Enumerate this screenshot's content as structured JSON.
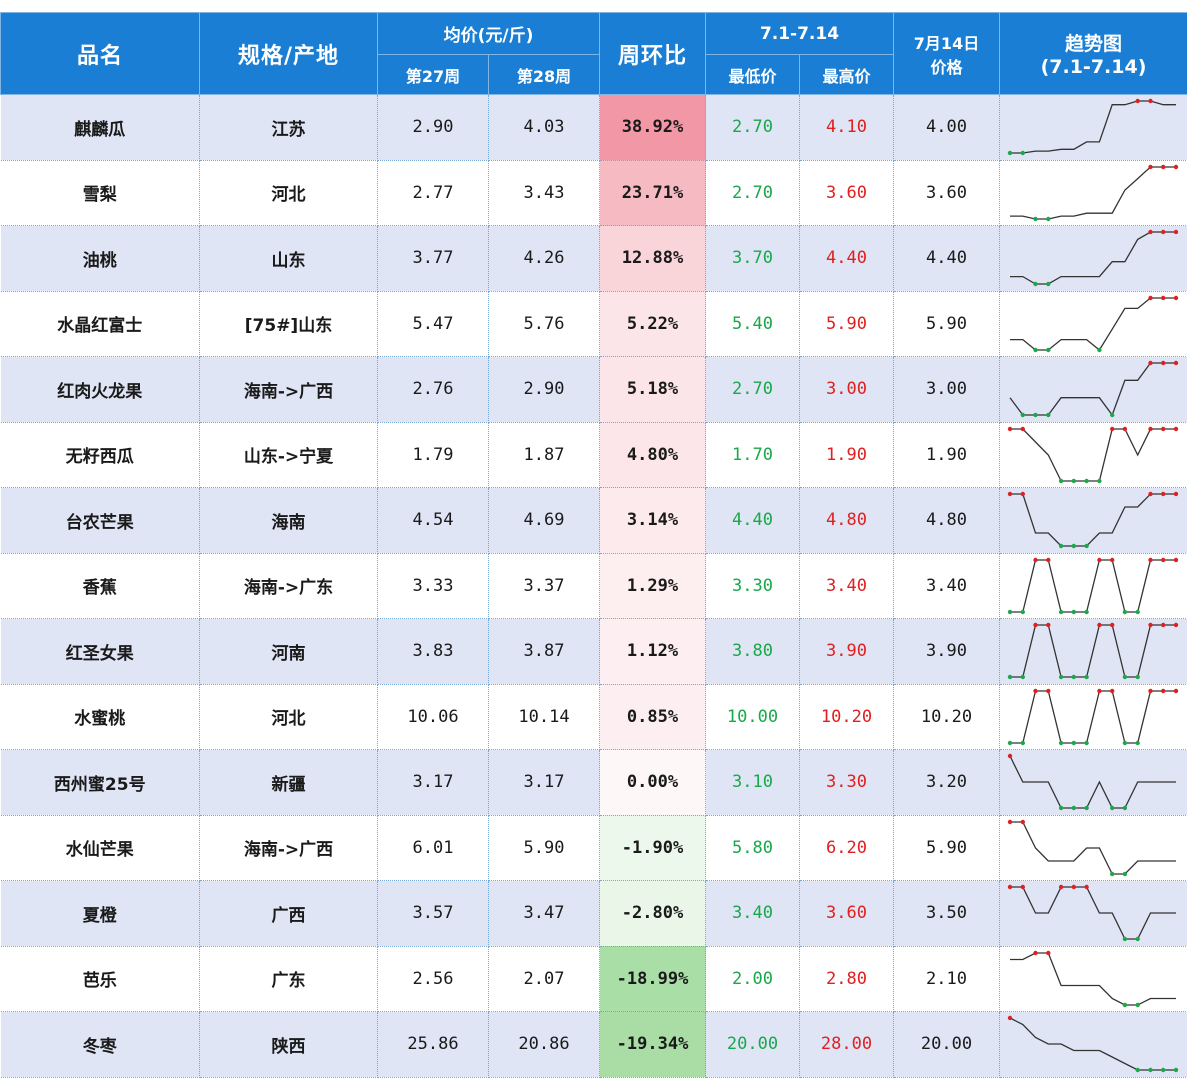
{
  "header": {
    "name": "品名",
    "spec": "规格/产地",
    "avg": "均价(元/斤)",
    "w27": "第27周",
    "w28": "第28周",
    "wow": "周环比",
    "range": "7.1-7.14",
    "min": "最低价",
    "max": "最高价",
    "today_line1": "7月14日",
    "today_line2": "价格",
    "trend_line1": "趋势图",
    "trend_line2": "(7.1-7.14)"
  },
  "colors": {
    "header_bg": "#1a7ed4",
    "row_odd": "#dfe5f5",
    "min_green": "#19a84a",
    "max_red": "#e02020",
    "pct_pos": "#f4a6b0",
    "pct_neg": "#a8dba6"
  },
  "rows": [
    {
      "name": "麒麟瓜",
      "origin": "江苏",
      "w27": "2.90",
      "w28": "4.03",
      "wow": "38.92%",
      "wow_num": 38.92,
      "min": "2.70",
      "max": "4.10",
      "today": "4.00",
      "trend": [
        2.7,
        2.7,
        2.75,
        2.75,
        2.8,
        2.8,
        3.0,
        3.0,
        4.0,
        4.0,
        4.1,
        4.1,
        4.0,
        4.0
      ]
    },
    {
      "name": "雪梨",
      "origin": "河北",
      "w27": "2.77",
      "w28": "3.43",
      "wow": "23.71%",
      "wow_num": 23.71,
      "min": "2.70",
      "max": "3.60",
      "today": "3.60",
      "trend": [
        2.75,
        2.75,
        2.7,
        2.7,
        2.75,
        2.75,
        2.8,
        2.8,
        2.8,
        3.2,
        3.4,
        3.6,
        3.6,
        3.6
      ]
    },
    {
      "name": "油桃",
      "origin": "山东",
      "w27": "3.77",
      "w28": "4.26",
      "wow": "12.88%",
      "wow_num": 12.88,
      "min": "3.70",
      "max": "4.40",
      "today": "4.40",
      "trend": [
        3.8,
        3.8,
        3.7,
        3.7,
        3.8,
        3.8,
        3.8,
        3.8,
        4.0,
        4.0,
        4.3,
        4.4,
        4.4,
        4.4
      ]
    },
    {
      "name": "水晶红富士",
      "origin": "[75#]山东",
      "w27": "5.47",
      "w28": "5.76",
      "wow": "5.22%",
      "wow_num": 5.22,
      "min": "5.40",
      "max": "5.90",
      "today": "5.90",
      "trend": [
        5.5,
        5.5,
        5.4,
        5.4,
        5.5,
        5.5,
        5.5,
        5.4,
        5.6,
        5.8,
        5.8,
        5.9,
        5.9,
        5.9
      ]
    },
    {
      "name": "红肉火龙果",
      "origin": "海南->广西",
      "w27": "2.76",
      "w28": "2.90",
      "wow": "5.18%",
      "wow_num": 5.18,
      "min": "2.70",
      "max": "3.00",
      "today": "3.00",
      "trend": [
        2.8,
        2.7,
        2.7,
        2.7,
        2.8,
        2.8,
        2.8,
        2.8,
        2.7,
        2.9,
        2.9,
        3.0,
        3.0,
        3.0
      ]
    },
    {
      "name": "无籽西瓜",
      "origin": "山东->宁夏",
      "w27": "1.79",
      "w28": "1.87",
      "wow": "4.80%",
      "wow_num": 4.8,
      "min": "1.70",
      "max": "1.90",
      "today": "1.90",
      "trend": [
        1.9,
        1.9,
        1.85,
        1.8,
        1.7,
        1.7,
        1.7,
        1.7,
        1.9,
        1.9,
        1.8,
        1.9,
        1.9,
        1.9
      ]
    },
    {
      "name": "台农芒果",
      "origin": "海南",
      "w27": "4.54",
      "w28": "4.69",
      "wow": "3.14%",
      "wow_num": 3.14,
      "min": "4.40",
      "max": "4.80",
      "today": "4.80",
      "trend": [
        4.8,
        4.8,
        4.5,
        4.5,
        4.4,
        4.4,
        4.4,
        4.5,
        4.5,
        4.7,
        4.7,
        4.8,
        4.8,
        4.8
      ]
    },
    {
      "name": "香蕉",
      "origin": "海南->广东",
      "w27": "3.33",
      "w28": "3.37",
      "wow": "1.29%",
      "wow_num": 1.29,
      "min": "3.30",
      "max": "3.40",
      "today": "3.40",
      "trend": [
        3.3,
        3.3,
        3.4,
        3.4,
        3.3,
        3.3,
        3.3,
        3.4,
        3.4,
        3.3,
        3.3,
        3.4,
        3.4,
        3.4
      ]
    },
    {
      "name": "红圣女果",
      "origin": "河南",
      "w27": "3.83",
      "w28": "3.87",
      "wow": "1.12%",
      "wow_num": 1.12,
      "min": "3.80",
      "max": "3.90",
      "today": "3.90",
      "trend": [
        3.8,
        3.8,
        3.9,
        3.9,
        3.8,
        3.8,
        3.8,
        3.9,
        3.9,
        3.8,
        3.8,
        3.9,
        3.9,
        3.9
      ]
    },
    {
      "name": "水蜜桃",
      "origin": "河北",
      "w27": "10.06",
      "w28": "10.14",
      "wow": "0.85%",
      "wow_num": 0.85,
      "min": "10.00",
      "max": "10.20",
      "today": "10.20",
      "trend": [
        10.0,
        10.0,
        10.2,
        10.2,
        10.0,
        10.0,
        10.0,
        10.2,
        10.2,
        10.0,
        10.0,
        10.2,
        10.2,
        10.2
      ]
    },
    {
      "name": "西州蜜25号",
      "origin": "新疆",
      "w27": "3.17",
      "w28": "3.17",
      "wow": "0.00%",
      "wow_num": 0.0,
      "min": "3.10",
      "max": "3.30",
      "today": "3.20",
      "trend": [
        3.3,
        3.2,
        3.2,
        3.2,
        3.1,
        3.1,
        3.1,
        3.2,
        3.1,
        3.1,
        3.2,
        3.2,
        3.2,
        3.2
      ]
    },
    {
      "name": "水仙芒果",
      "origin": "海南->广西",
      "w27": "6.01",
      "w28": "5.90",
      "wow": "-1.90%",
      "wow_num": -1.9,
      "min": "5.80",
      "max": "6.20",
      "today": "5.90",
      "trend": [
        6.2,
        6.2,
        6.0,
        5.9,
        5.9,
        5.9,
        6.0,
        6.0,
        5.8,
        5.8,
        5.9,
        5.9,
        5.9,
        5.9
      ]
    },
    {
      "name": "夏橙",
      "origin": "广西",
      "w27": "3.57",
      "w28": "3.47",
      "wow": "-2.80%",
      "wow_num": -2.8,
      "min": "3.40",
      "max": "3.60",
      "today": "3.50",
      "trend": [
        3.6,
        3.6,
        3.5,
        3.5,
        3.6,
        3.6,
        3.6,
        3.5,
        3.5,
        3.4,
        3.4,
        3.5,
        3.5,
        3.5
      ]
    },
    {
      "name": "芭乐",
      "origin": "广东",
      "w27": "2.56",
      "w28": "2.07",
      "wow": "-18.99%",
      "wow_num": -18.99,
      "min": "2.00",
      "max": "2.80",
      "today": "2.10",
      "trend": [
        2.7,
        2.7,
        2.8,
        2.8,
        2.3,
        2.3,
        2.3,
        2.3,
        2.1,
        2.0,
        2.0,
        2.1,
        2.1,
        2.1
      ]
    },
    {
      "name": "冬枣",
      "origin": "陕西",
      "w27": "25.86",
      "w28": "20.86",
      "wow": "-19.34%",
      "wow_num": -19.34,
      "min": "20.00",
      "max": "28.00",
      "today": "20.00",
      "trend": [
        28.0,
        27.0,
        25.0,
        24.0,
        24.0,
        23.0,
        23.0,
        23.0,
        22.0,
        21.0,
        20.0,
        20.0,
        20.0,
        20.0
      ]
    }
  ]
}
